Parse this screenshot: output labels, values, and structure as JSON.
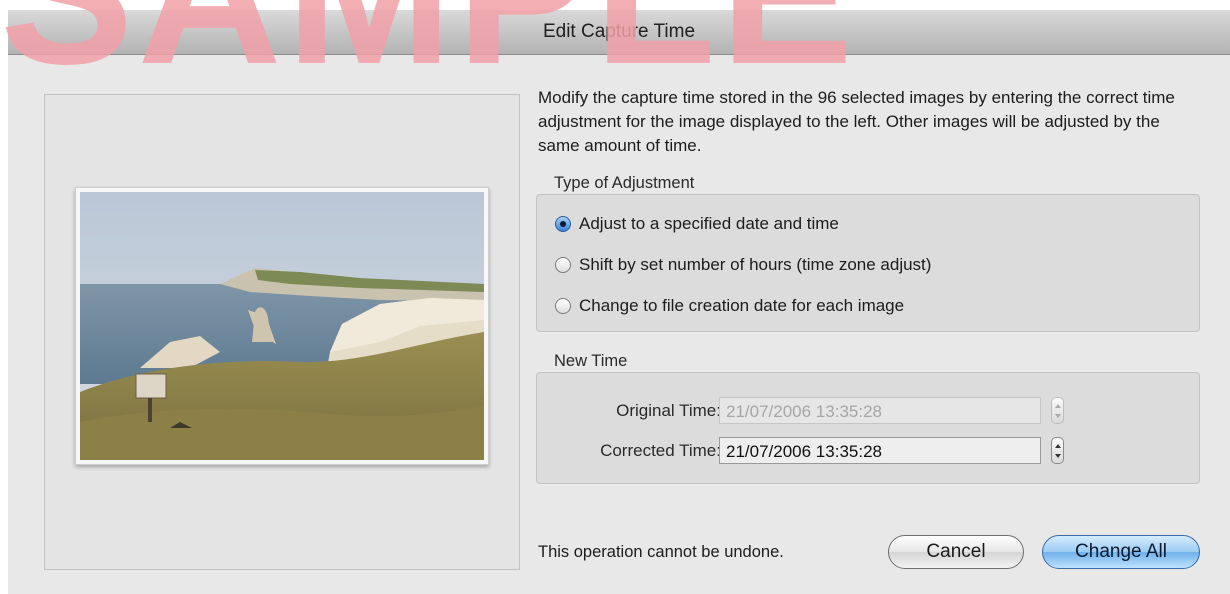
{
  "window": {
    "title": "Edit Capture Time"
  },
  "watermark": "SAMPLE",
  "description": "Modify the capture time stored in the 96 selected images by entering the correct time adjustment for the image displayed to the left. Other images will be adjusted by the same amount of time.",
  "adjustment": {
    "label": "Type of Adjustment",
    "options": [
      {
        "label": "Adjust to a specified date and time",
        "selected": true
      },
      {
        "label": "Shift by set number of hours (time zone adjust)",
        "selected": false
      },
      {
        "label": "Change to file creation date for each image",
        "selected": false
      }
    ]
  },
  "new_time": {
    "label": "New Time",
    "original_label": "Original Time:",
    "original_value": "21/07/2006 13:35:28",
    "corrected_label": "Corrected Time:",
    "corrected_value": "21/07/2006 13:35:28"
  },
  "footer": {
    "warning": "This operation cannot be undone.",
    "cancel_label": "Cancel",
    "change_all_label": "Change All"
  },
  "colors": {
    "accent": "#6eb0ea",
    "watermark": "#f2a0a8"
  },
  "icons": {
    "radio_selected": "radio-selected-icon",
    "stepper": "stepper-arrows-icon"
  }
}
